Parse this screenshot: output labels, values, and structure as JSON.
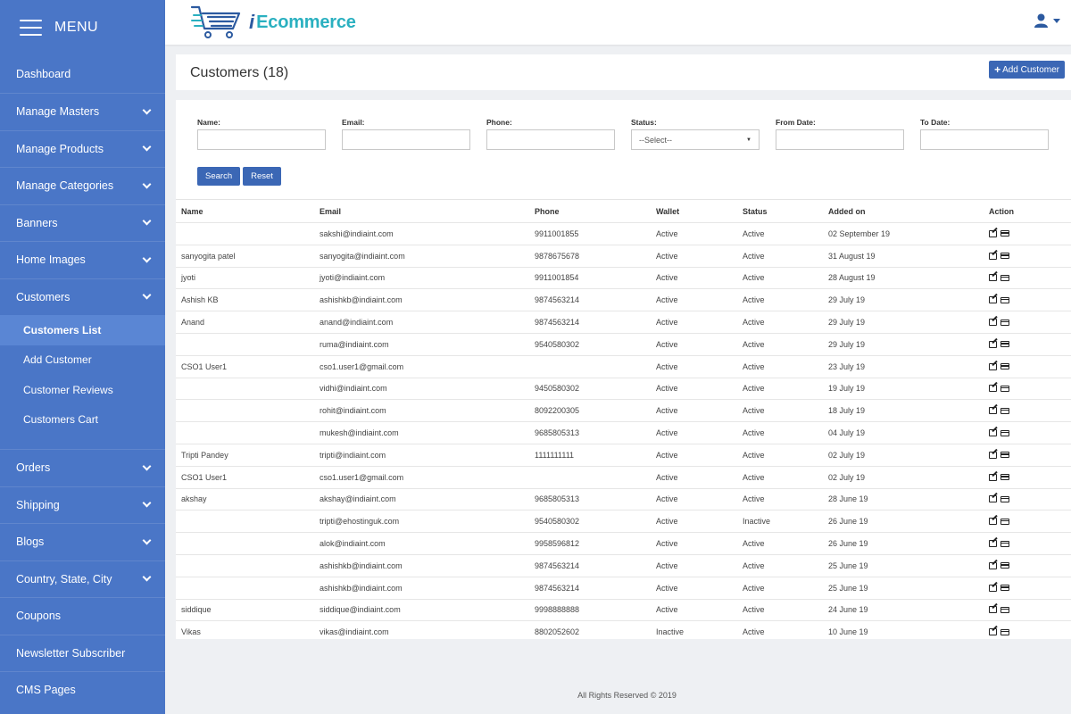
{
  "sidebar": {
    "menu_title": "MENU",
    "items": [
      {
        "label": "Dashboard"
      },
      {
        "label": "Manage Masters"
      },
      {
        "label": "Manage Products"
      },
      {
        "label": "Manage Categories"
      },
      {
        "label": "Banners"
      },
      {
        "label": "Home Images"
      },
      {
        "label": "Customers"
      },
      {
        "label": "Orders"
      },
      {
        "label": "Shipping"
      },
      {
        "label": "Blogs"
      },
      {
        "label": "Country, State, City"
      },
      {
        "label": "Coupons"
      },
      {
        "label": "Newsletter Subscriber"
      },
      {
        "label": "CMS Pages"
      }
    ],
    "customers_sub": [
      "Customers List",
      "Add Customer",
      "Customer Reviews",
      "Customers Cart"
    ]
  },
  "header": {
    "logo_letter": "i",
    "logo_text": "Ecommerce"
  },
  "title": {
    "page_title": "Customers (18)",
    "add_button": "Add Customer"
  },
  "filters": {
    "name_label": "Name:",
    "email_label": "Email:",
    "phone_label": "Phone:",
    "status_label": "Status:",
    "status_value": "--Select--",
    "from_label": "From Date:",
    "to_label": "To Date:",
    "search_button": "Search",
    "reset_button": "Reset"
  },
  "table": {
    "headers": [
      "Name",
      "Email",
      "Phone",
      "Wallet",
      "Status",
      "Added on",
      "Action"
    ],
    "rows": [
      [
        "",
        "sakshi@indiaint.com",
        "9911001855",
        "Active",
        "Active",
        "02 September 19"
      ],
      [
        "sanyogita patel",
        "sanyogita@indiaint.com",
        "9878675678",
        "Active",
        "Active",
        "31 August 19"
      ],
      [
        "jyoti",
        "jyoti@indiaint.com",
        "9911001854",
        "Active",
        "Active",
        "28 August 19"
      ],
      [
        "Ashish KB",
        "ashishkb@indiaint.com",
        "9874563214",
        "Active",
        "Active",
        "29 July 19"
      ],
      [
        "Anand",
        "anand@indiaint.com",
        "9874563214",
        "Active",
        "Active",
        "29 July 19"
      ],
      [
        "",
        "ruma@indiaint.com",
        "9540580302",
        "Active",
        "Active",
        "29 July 19"
      ],
      [
        "CSO1 User1",
        "cso1.user1@gmail.com",
        "",
        "Active",
        "Active",
        "23 July 19"
      ],
      [
        "",
        "vidhi@indiaint.com",
        "9450580302",
        "Active",
        "Active",
        "19 July 19"
      ],
      [
        "",
        "rohit@indiaint.com",
        "8092200305",
        "Active",
        "Active",
        "18 July 19"
      ],
      [
        "",
        "mukesh@indiaint.com",
        "9685805313",
        "Active",
        "Active",
        "04 July 19"
      ],
      [
        "Tripti Pandey",
        "tripti@indiaint.com",
        "1111111111",
        "Active",
        "Active",
        "02 July 19"
      ],
      [
        "CSO1 User1",
        "cso1.user1@gmail.com",
        "",
        "Active",
        "Active",
        "02 July 19"
      ],
      [
        "akshay",
        "akshay@indiaint.com",
        "9685805313",
        "Active",
        "Active",
        "28 June 19"
      ],
      [
        "",
        "tripti@ehostinguk.com",
        "9540580302",
        "Active",
        "Inactive",
        "26 June 19"
      ],
      [
        "",
        "alok@indiaint.com",
        "9958596812",
        "Active",
        "Active",
        "26 June 19"
      ],
      [
        "",
        "ashishkb@indiaint.com",
        "9874563214",
        "Active",
        "Active",
        "25 June 19"
      ],
      [
        "",
        "ashishkb@indiaint.com",
        "9874563214",
        "Active",
        "Active",
        "25 June 19"
      ],
      [
        "siddique",
        "siddique@indiaint.com",
        "9998888888",
        "Active",
        "Active",
        "24 June 19"
      ],
      [
        "Vikas",
        "vikas@indiaint.com",
        "8802052602",
        "Inactive",
        "Active",
        "10 June 19"
      ]
    ]
  },
  "footer": "All Rights Reserved © 2019",
  "colors": {
    "sidebar": "#4a76c7",
    "accent": "#3b67b5",
    "logo_teal": "#2ab0c0"
  }
}
